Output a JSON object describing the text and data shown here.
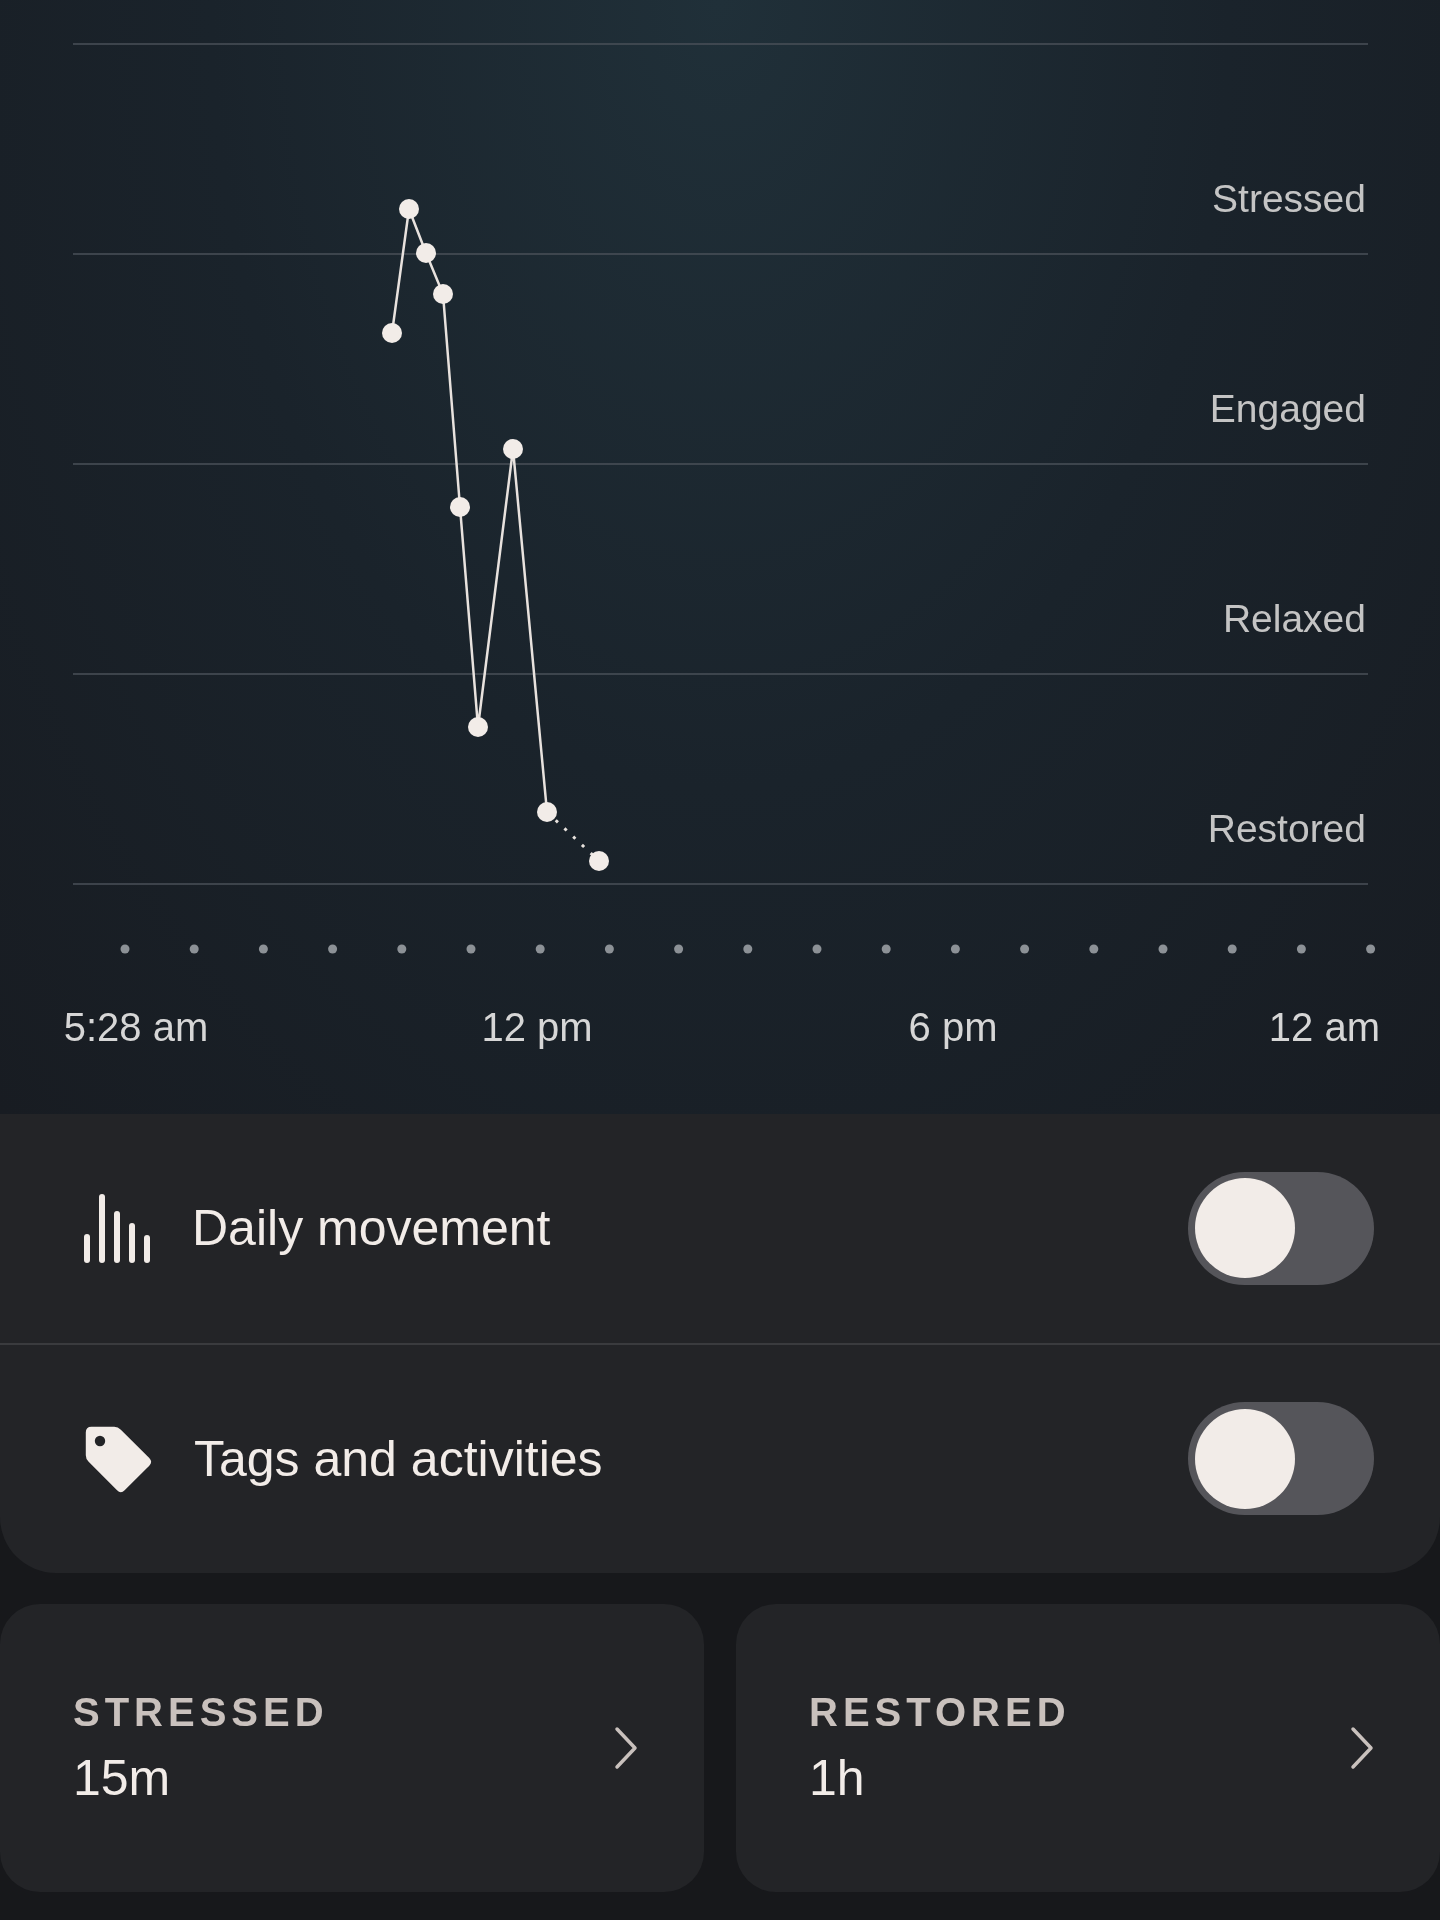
{
  "stress_chart": {
    "levels": [
      "Stressed",
      "Engaged",
      "Relaxed",
      "Restored"
    ],
    "time_labels": [
      "5:28 am",
      "12 pm",
      "6 pm",
      "12 am"
    ]
  },
  "toggles": [
    {
      "kind": "movement",
      "label": "Daily movement",
      "on": false
    },
    {
      "kind": "tags",
      "label": "Tags and activities",
      "on": false
    }
  ],
  "summary": [
    {
      "label": "STRESSED",
      "value": "15m"
    },
    {
      "label": "RESTORED",
      "value": "1h"
    }
  ]
}
